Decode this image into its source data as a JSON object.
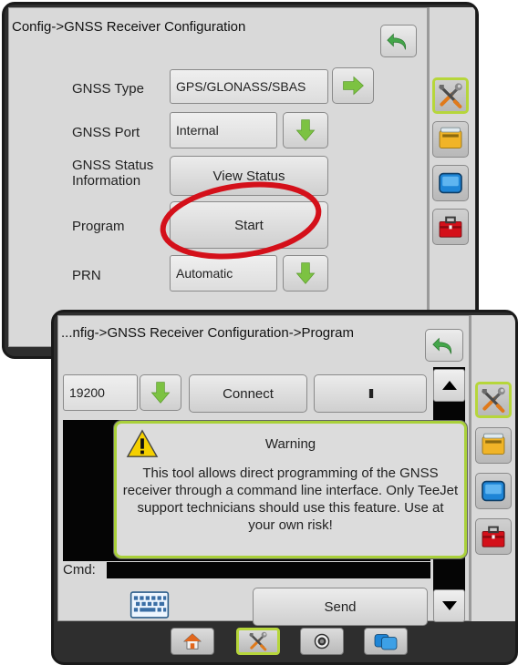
{
  "config_screen": {
    "breadcrumb": "Config->GNSS Receiver Configuration",
    "rows": [
      {
        "label": "GNSS Type",
        "value": "GPS/GLONASS/SBAS"
      },
      {
        "label": "GNSS Port",
        "value": "Internal"
      },
      {
        "label": "GNSS Status Information",
        "button": "View Status"
      },
      {
        "label": "Program",
        "button": "Start"
      },
      {
        "label": "PRN",
        "value": "Automatic"
      }
    ]
  },
  "program_screen": {
    "breadcrumb": "...nfig->GNSS Receiver Configuration->Program",
    "baud_rate": "19200",
    "connect_label": "Connect",
    "pause_label": "II",
    "cmd_label": "Cmd:",
    "cmd_value": "",
    "send_label": "Send",
    "warning": {
      "title": "Warning",
      "message": "This tool allows direct programming of the GNSS receiver through a command line interface. Only TeeJet support technicians should use this feature. Use at your own risk!"
    }
  },
  "side_tabs": [
    "tools-icon",
    "console-tray-icon",
    "display-icon",
    "toolbox-icon"
  ],
  "bottom_tabs": [
    "home-icon",
    "tools-icon",
    "camera-icon",
    "guidance-icon"
  ],
  "colors": {
    "accent_green": "#7cc242",
    "active_border": "#b6d63b",
    "highlight_red": "#d4101a",
    "warning_yellow": "#f5d000"
  }
}
